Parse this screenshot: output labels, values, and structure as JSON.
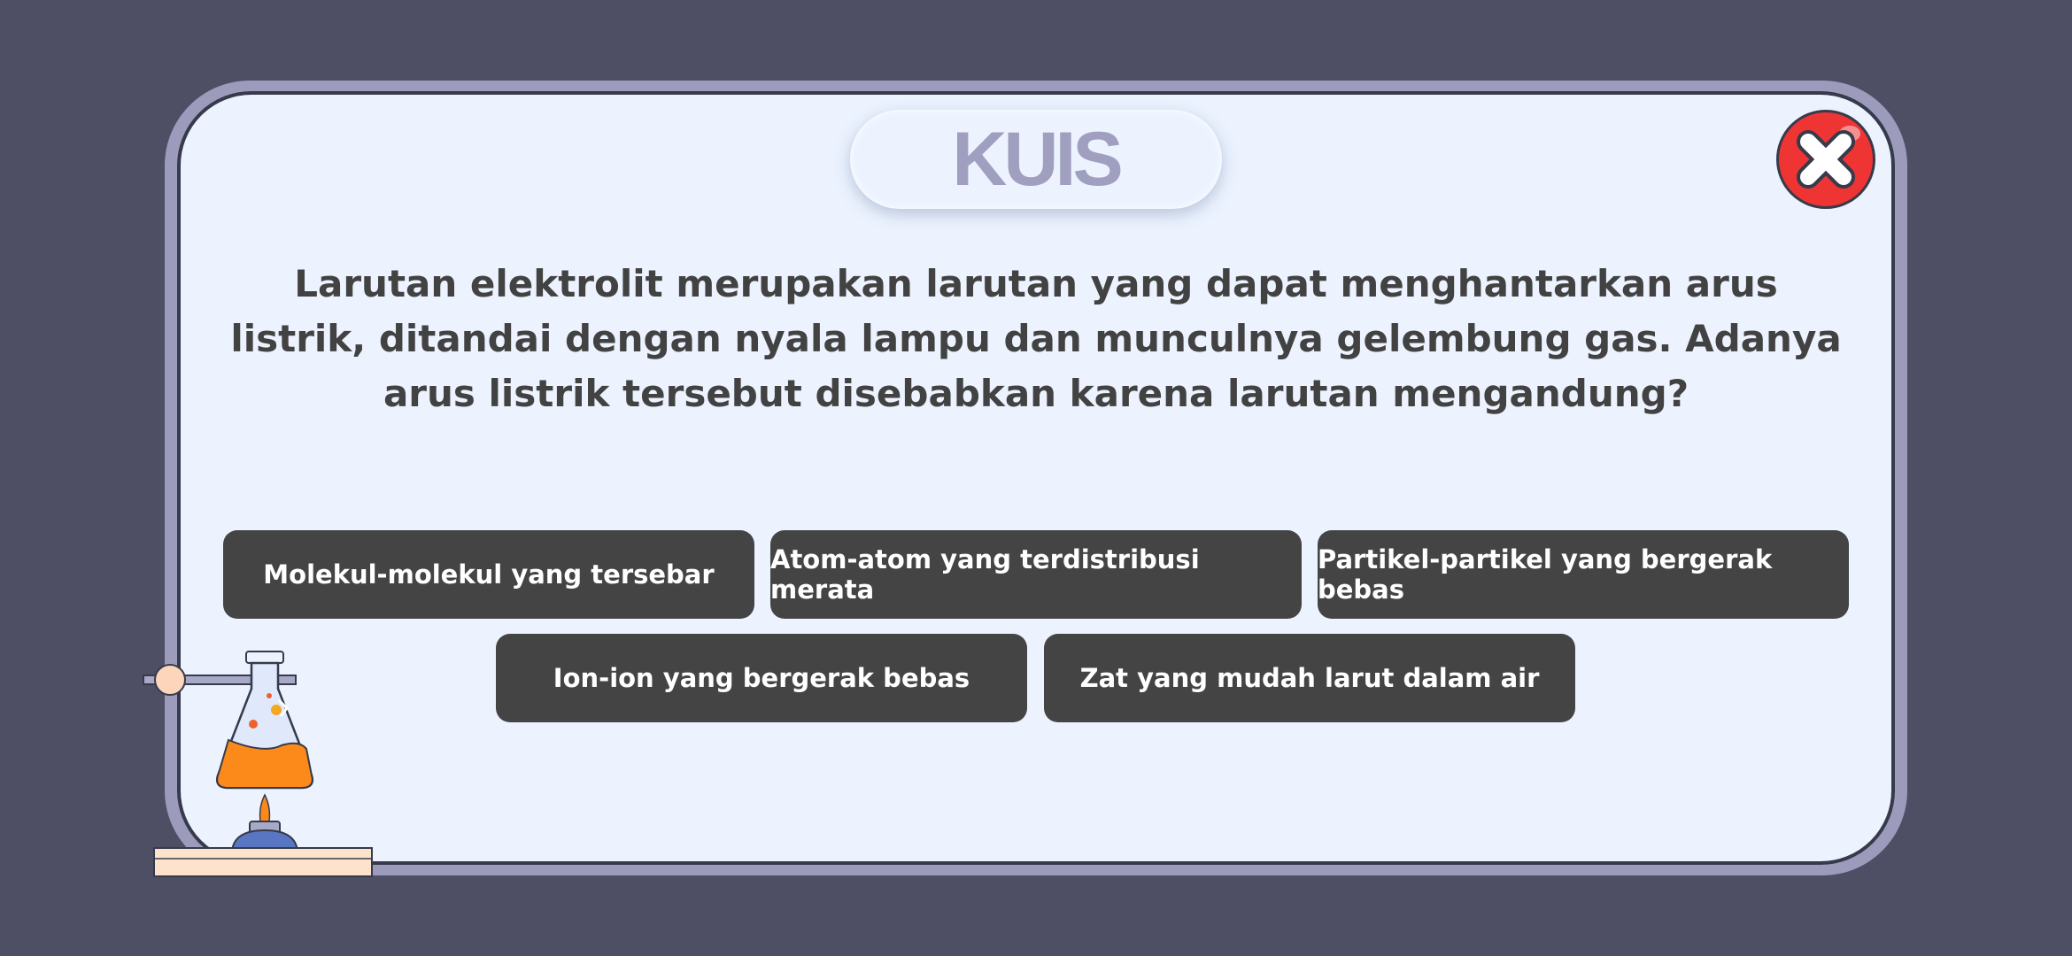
{
  "quiz": {
    "title": "KUIS",
    "question": "Larutan elektrolit merupakan larutan yang dapat menghantarkan arus listrik, ditandai dengan nyala lampu dan munculnya gelembung gas. Adanya arus listrik tersebut disebabkan karena larutan mengandung?",
    "answers": [
      "Molekul-molekul yang tersebar",
      "Atom-atom yang terdistribusi merata",
      "Partikel-partikel yang bergerak bebas",
      "Ion-ion yang bergerak bebas",
      "Zat yang mudah larut dalam air"
    ]
  },
  "icons": {
    "close": "close-x-icon",
    "decoration": "lab-flask-burner-icon"
  },
  "colors": {
    "background": "#4e4f65",
    "panel_border": "#9d9bbc",
    "panel_fill": "#ecf3ff",
    "title_text": "#a09fbf",
    "question_text": "#424242",
    "answer_button": "#444444",
    "close_button": "#ef3434",
    "flask_liquid": "#fb8a1a"
  }
}
